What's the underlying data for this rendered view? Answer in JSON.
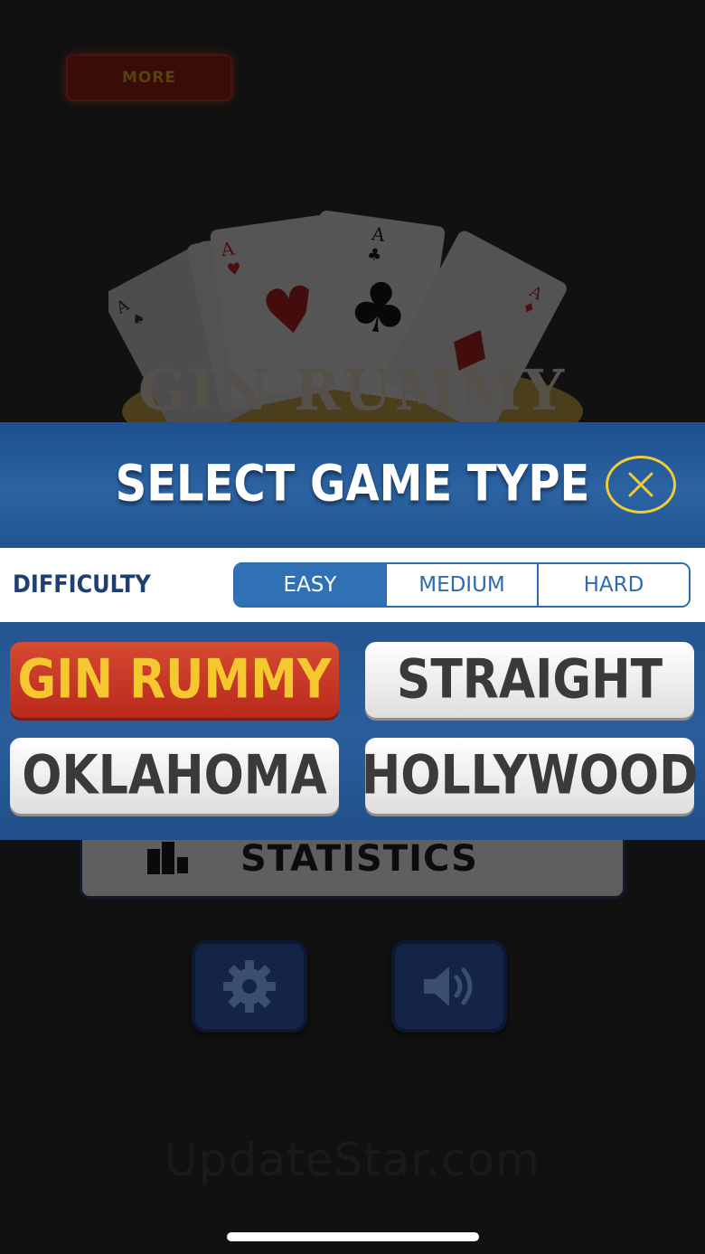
{
  "menu": {
    "more_label": "MORE",
    "logo_title": "GIN RUMMY",
    "statistics_label": "STATISTICS",
    "settings_icon": "gear-icon",
    "sound_icon": "speaker-icon"
  },
  "watermark": "UpdateStar.com",
  "modal": {
    "title": "SELECT GAME TYPE",
    "close_icon": "close-icon",
    "difficulty_label": "DIFFICULTY",
    "difficulty_options": [
      "EASY",
      "MEDIUM",
      "HARD"
    ],
    "difficulty_selected": "EASY",
    "game_types": [
      "GIN RUMMY",
      "STRAIGHT",
      "OKLAHOMA",
      "HOLLYWOOD"
    ],
    "game_selected": "GIN RUMMY"
  },
  "colors": {
    "accent_blue": "#2e6bb0",
    "header_blue": "#2b63a3",
    "selected_red": "#c8342a",
    "selected_text": "#f5c830",
    "close_yellow": "#f1cc33"
  }
}
